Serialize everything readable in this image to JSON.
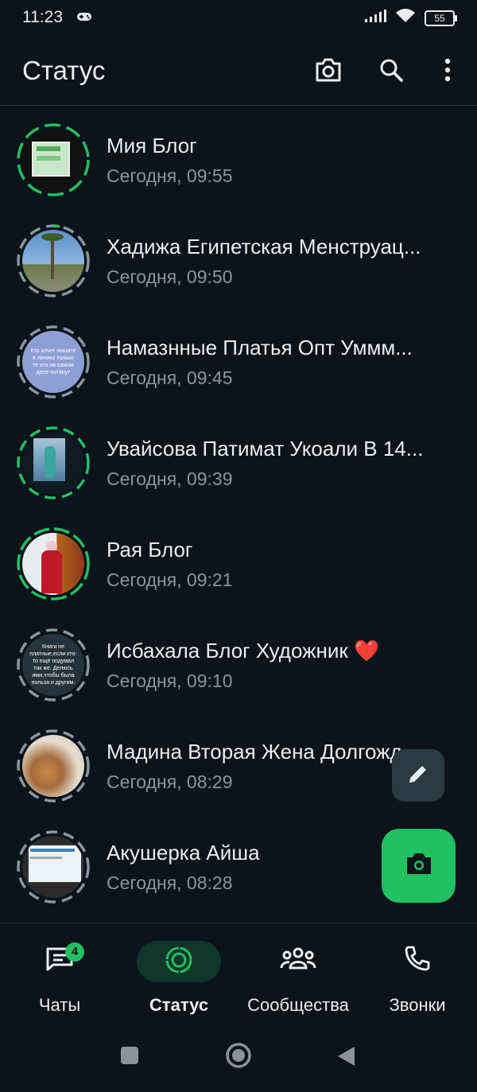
{
  "status_bar": {
    "time": "11:23",
    "battery": "55"
  },
  "header": {
    "title": "Статус"
  },
  "statuses": [
    {
      "name": "Мия Блог",
      "time": "Сегодня, 09:55"
    },
    {
      "name": "Хадижа Египетская Менструац...",
      "time": "Сегодня, 09:50"
    },
    {
      "name": "Намазнные Платья Опт Уммм...",
      "time": "Сегодня, 09:45",
      "thumb_text": "Кто хочет пишите в личико только те кто на самом деле потянут"
    },
    {
      "name": "Увайсова Патимат Укоали В 14...",
      "time": "Сегодня, 09:39"
    },
    {
      "name": "Рая Блог",
      "time": "Сегодня, 09:21"
    },
    {
      "name": "Исбахала Блог Художник ❤️",
      "time": "Сегодня, 09:10",
      "thumb_text": "Книги не платные,если кто-то ещё подумал так же. Делюсь ими,чтобы была польза и другим."
    },
    {
      "name": "Мадина Вторая Жена Долгожд...",
      "time": "Сегодня, 08:29"
    },
    {
      "name": "Акушерка Айша",
      "time": "Сегодня, 08:28"
    }
  ],
  "nav": {
    "chats": {
      "label": "Чаты",
      "badge": "4"
    },
    "status": {
      "label": "Статус"
    },
    "communities": {
      "label": "Сообщества"
    },
    "calls": {
      "label": "Звонки"
    }
  },
  "colors": {
    "background": "#0b141a",
    "accent": "#21c063",
    "unseen_ring": "#21c063",
    "seen_ring": "#8696a0"
  }
}
